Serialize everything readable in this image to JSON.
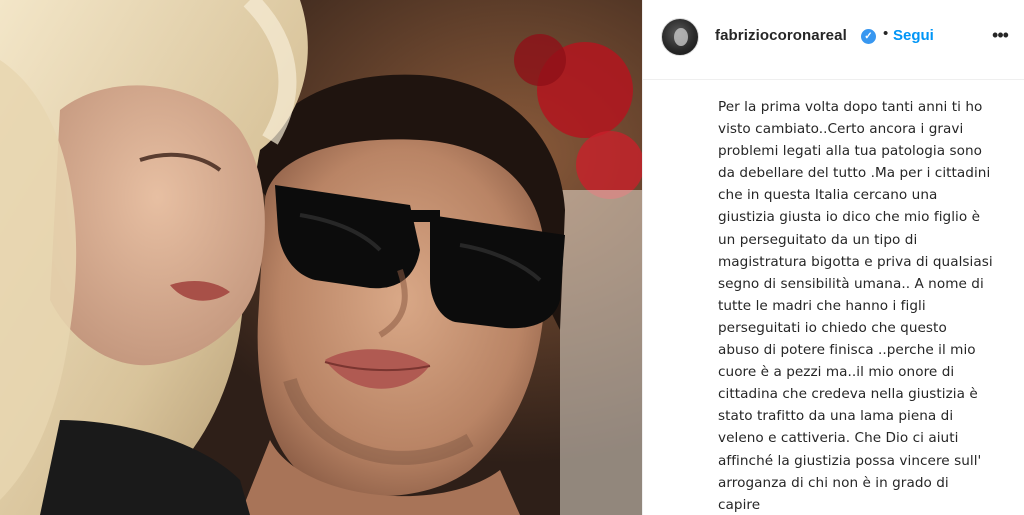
{
  "post": {
    "photo_alt": "Foto: donna bionda accanto a uomo con occhiali da sole scuri",
    "header": {
      "username": "fabriziocoronareal",
      "verified_icon": "verified-badge-icon",
      "separator": "•",
      "follow_label": "Segui",
      "more_icon": "more-options-icon",
      "more_label": "•••"
    },
    "caption_lines": [
      "Per la prima volta dopo tanti anni ti ho",
      "visto cambiato..Certo ancora i gravi",
      "problemi legati alla tua patologia sono",
      "da debellare del tutto .Ma per i cittadini",
      "che in questa Italia cercano una",
      "giustizia giusta io dico che mio figlio è",
      "un perseguitato da un tipo di",
      "magistratura bigotta e priva di qualsiasi",
      "segno di sensibilità umana.. A nome di",
      "tutte le madri che hanno i figli",
      "perseguitati io chiedo che questo",
      "abuso di potere finisca ..perche il mio",
      "cuore è a pezzi ma..il mio onore di",
      "cittadina che credeva nella giustizia è",
      "stato trafitto da una lama piena di",
      "veleno e cattiveria. Che Dio ci aiuti",
      "affinché la giustizia possa vincere sull'",
      "arroganza di chi non è in grado di",
      "capire"
    ],
    "colors": {
      "follow": "#0095f6",
      "verified": "#3897f0",
      "text": "#262626"
    }
  }
}
